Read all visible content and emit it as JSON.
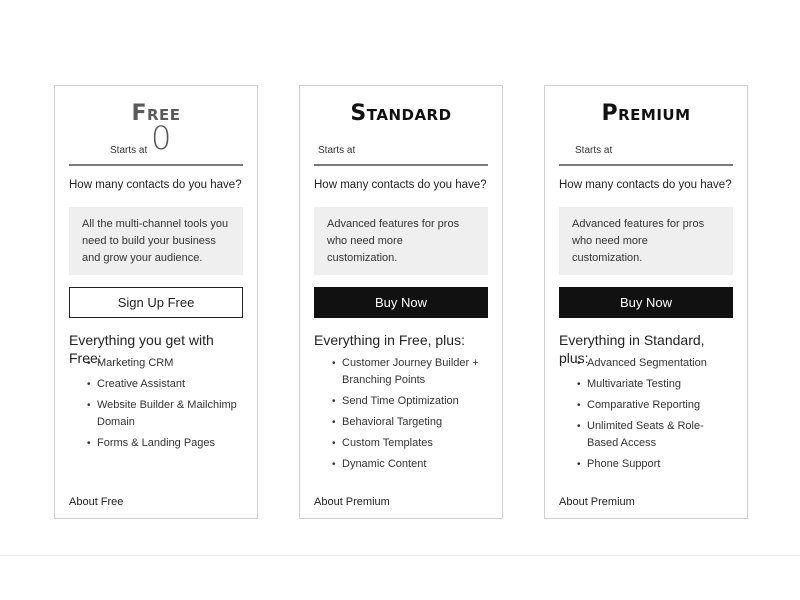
{
  "plans": [
    {
      "title": "Free",
      "starts_at_label": "Starts at",
      "price": "0",
      "contacts_question": "How many contacts do you have?",
      "description": "All the multi-channel tools you need to build your business and grow your audience.",
      "cta_label": "Sign Up Free",
      "features_title": "Everything you get with Free:",
      "features": [
        "Marketing CRM",
        "Creative Assistant",
        "Website Builder & Mailchimp Domain",
        "Forms & Landing Pages"
      ],
      "about_link": "About Free"
    },
    {
      "title": "Standard",
      "starts_at_label": "Starts at",
      "price": "",
      "contacts_question": "How many contacts do you have?",
      "description": "Advanced features for pros who need more customization.",
      "cta_label": "Buy Now",
      "features_title": "Everything in Free, plus:",
      "features": [
        "Customer Journey Builder + Branching Points",
        "Send Time Optimization",
        "Behavioral Targeting",
        "Custom Templates",
        "Dynamic Content"
      ],
      "about_link": "About Premium"
    },
    {
      "title": "Premium",
      "starts_at_label": "Starts at",
      "price": "",
      "contacts_question": "How many contacts do you have?",
      "description": "Advanced features for pros who need more customization.",
      "cta_label": "Buy Now",
      "features_title": "Everything in Standard, plus:",
      "features": [
        "Advanced Segmentation",
        "Multivariate Testing",
        "Comparative Reporting",
        "Unlimited Seats & Role-Based Access",
        "Phone Support"
      ],
      "about_link": "About Premium"
    }
  ],
  "bullet_glyph": "•",
  "colors": {
    "primary_button": "#111111",
    "description_bg": "#efefef",
    "card_border": "#cfcfcf"
  }
}
